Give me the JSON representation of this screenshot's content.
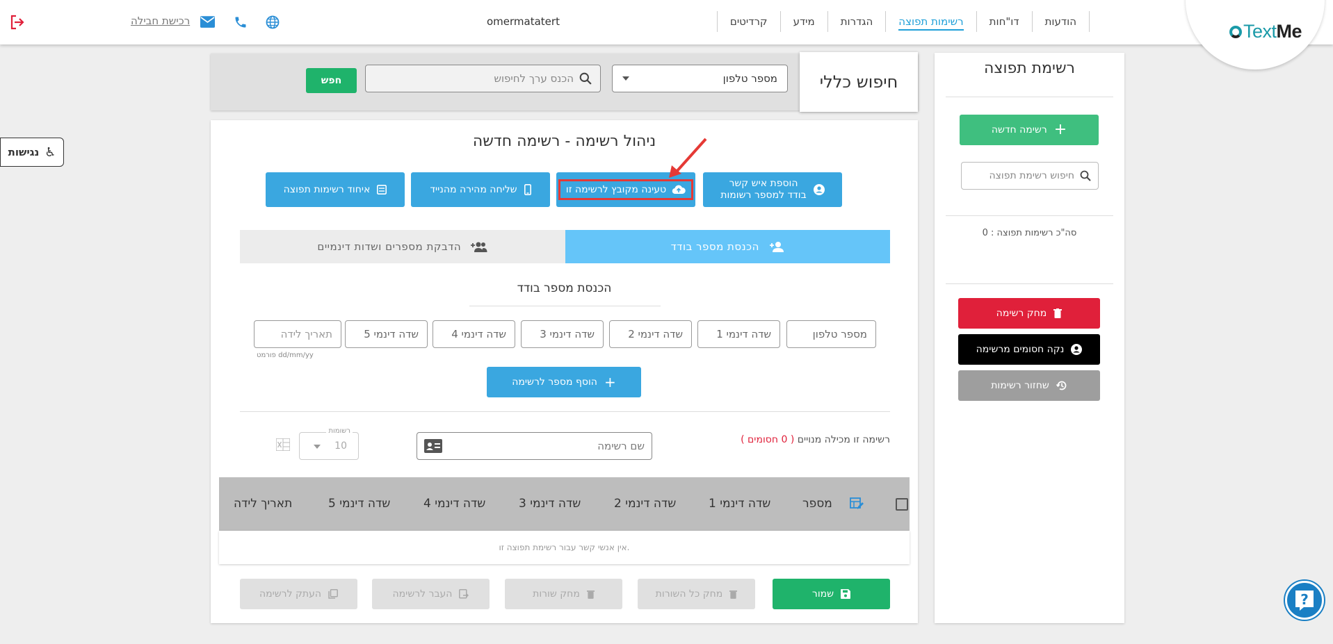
{
  "topbar": {
    "logo_prefix": "Text",
    "logo_suffix": "Me",
    "nav": [
      {
        "label": "הודעות",
        "active": false
      },
      {
        "label": "דו\"חות",
        "active": false
      },
      {
        "label": "רשימות תפוצה",
        "active": true
      },
      {
        "label": "הגדרות",
        "active": false
      },
      {
        "label": "מידע",
        "active": false
      },
      {
        "label": "קרדיטים",
        "active": false
      }
    ],
    "username": "omermatatert",
    "buy_package": "רכישת חבילה"
  },
  "accessibility": {
    "label": "נגישות"
  },
  "sidebar": {
    "title": "רשימת תפוצה",
    "new_list": "רשימה חדשה",
    "search_placeholder": "חיפוש רשימת תפוצה",
    "total": "סה\"כ רשימות תפוצה : 0",
    "delete_list": "מחק רשימה",
    "clear_blocked": "נקה חסומים מרשימה",
    "restore_lists": "שחזור רשימות"
  },
  "search": {
    "title": "חיפוש כללי",
    "field_selected": "מספר טלפון",
    "input_placeholder": "הכנס ערך לחיפוש",
    "button": "חפש"
  },
  "main": {
    "title": "ניהול רשימה - רשימה חדשה",
    "actions": {
      "add_contact_line1": "הוספת איש קשר",
      "add_contact_line2": "בודד למספר רשומות",
      "upload_file": "טעינה מקובץ לרשימה זו",
      "quick_send": "שליחה מהירה מהנייד",
      "merge_lists": "איחוד רשימות תפוצה"
    },
    "tabs": {
      "single": "הכנסת מספר בודד",
      "paste": "הדבקת מספרים ושדות דינמיים"
    },
    "single_title": "הכנסת מספר בודד",
    "fields": [
      "מספר טלפון",
      "שדה דינמי 1",
      "שדה דינמי 2",
      "שדה דינמי 3",
      "שדה דינמי 4",
      "שדה דינמי 5",
      "תאריך לידה"
    ],
    "date_format": "פורמט dd/mm/yy",
    "add_number": "הוסף מספר לרשימה",
    "subscribers_text": "רשימה זו מכילה מנויים",
    "blocked_text": "( 0 חסומים )",
    "list_name_placeholder": "שם רשימה",
    "rows_label": "רשומות",
    "rows_value": "10",
    "table_headers": [
      "מספר",
      "שדה דינמי 1",
      "שדה דינמי 2",
      "שדה דינמי 3",
      "שדה דינמי 4",
      "שדה דינמי 5",
      "תאריך לידה"
    ],
    "empty_message": "אין אנשי קשר עבור רשימת תפוצה זו.",
    "footer": {
      "save": "שמור",
      "delete_all": "מחק כל השורות",
      "delete_rows": "מחק שורות",
      "move_to_list": "העבר לרשימה",
      "copy_to_list": "העתק לרשימה"
    }
  },
  "colors": {
    "accent_blue": "#3aa7e0",
    "green": "#1fb36b",
    "red": "#e0203a",
    "highlight": "#e53935"
  }
}
